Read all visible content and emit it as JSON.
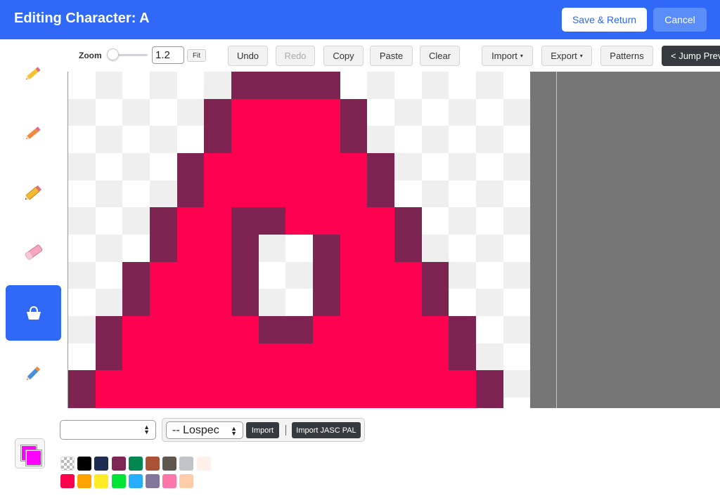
{
  "header": {
    "title": "Editing Character: A",
    "save_label": "Save & Return",
    "cancel_label": "Cancel"
  },
  "tools": [
    {
      "name": "pencil-yellow-icon",
      "active": false
    },
    {
      "name": "pencil-orange-icon",
      "active": false
    },
    {
      "name": "pencil-icon",
      "active": false
    },
    {
      "name": "eraser-icon",
      "active": false
    },
    {
      "name": "fill-bucket-icon",
      "active": true
    },
    {
      "name": "color-picker-pencil-icon",
      "active": false
    }
  ],
  "toolbar": {
    "zoom_label": "Zoom",
    "zoom_value": "1.2",
    "fit_label": "Fit",
    "undo": "Undo",
    "redo": "Redo",
    "copy": "Copy",
    "paste": "Paste",
    "clear": "Clear",
    "import": "Import",
    "export": "Export",
    "patterns": "Patterns",
    "jump_prev": "< Jump Prev"
  },
  "canvas": {
    "colors": {
      "fill": "#ff0050",
      "outline": "#7d2452",
      "checker_light": "#ffffff",
      "checker_dark": "#efefef",
      "background": "#767676"
    },
    "rows": [
      "......OOOO.......",
      ".....OFFFFO......",
      ".....OFFFFO......",
      "....OFFFFFFO.....",
      "....OFFFFFFO.....",
      "...OFFOOFFFFO....",
      "...OFFO..OFFO....",
      "..OFFFO..OFFFO...",
      "..OFFFO..OFFFO...",
      ".OFFFFFOOFFFFFO..",
      ".OFFFFFFFFFFFFO..",
      "OFFFFFFFFFFFFFFO.",
      "OFFFFFFFFFFFFFFO."
    ]
  },
  "palette_controls": {
    "select_value": "",
    "lospec_value": "-- Lospec",
    "import_label": "Import",
    "import_jasc_label": "Import JASC PAL"
  },
  "current_color": "#ff00ff",
  "palette_colors": [
    [
      "transparent",
      "#000000",
      "#1d2b53",
      "#7e2553",
      "#008751",
      "#ab5236",
      "#5f574f",
      "#c2c3c7",
      "#fff1e8"
    ],
    [
      "#ff004d",
      "#ffa300",
      "#ffec27",
      "#00e436",
      "#29adff",
      "#83769c",
      "#ff77a8",
      "#ffccaa"
    ]
  ]
}
